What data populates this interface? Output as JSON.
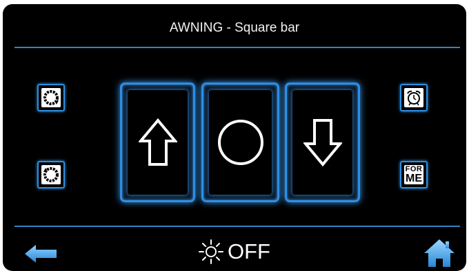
{
  "header": {
    "title": "AWNING - Square bar"
  },
  "status": {
    "text": "OFF",
    "icon": "sun-icon"
  },
  "left_buttons": [
    {
      "icon": "rotate-clockwise-icon"
    },
    {
      "icon": "rotate-counterclockwise-icon"
    }
  ],
  "right_buttons": [
    {
      "icon": "alarm-clock-icon"
    },
    {
      "label_line1": "FOR",
      "label_line2": "ME",
      "icon": "for-me-icon"
    }
  ],
  "controls": [
    {
      "icon": "arrow-up-icon"
    },
    {
      "icon": "stop-circle-icon"
    },
    {
      "icon": "arrow-down-icon"
    }
  ],
  "nav": {
    "back_icon": "back-arrow-icon",
    "home_icon": "home-icon"
  },
  "colors": {
    "accent": "#2e8ee4",
    "background": "#000000",
    "arrow": "#4aa8e8",
    "text": "#ffffff"
  }
}
